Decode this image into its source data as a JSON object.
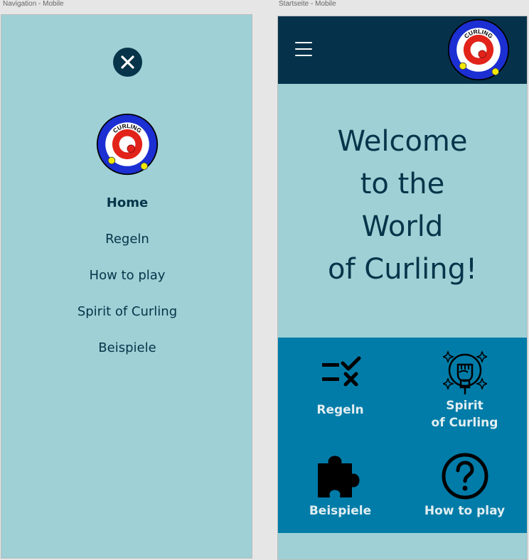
{
  "canvas": {
    "nav_artboard_title": "Navigation - Mobile",
    "home_artboard_title": "Startseite - Mobile"
  },
  "logo": {
    "text": "CURLING",
    "icon": "curling-target-logo"
  },
  "navigation": {
    "close_icon": "close-icon",
    "items": [
      {
        "label": "Home",
        "active": true
      },
      {
        "label": "Regeln",
        "active": false
      },
      {
        "label": "How to play",
        "active": false
      },
      {
        "label": "Spirit of Curling",
        "active": false
      },
      {
        "label": "Beispiele",
        "active": false
      }
    ]
  },
  "home": {
    "menu_icon": "hamburger-menu-icon",
    "welcome_lines": [
      "Welcome",
      "to the",
      "World",
      "of Curling!"
    ],
    "tiles": [
      {
        "label": "Regeln",
        "icon": "checklist-icon"
      },
      {
        "label": "Spirit\nof Curling",
        "icon": "raised-fist-badge-icon"
      },
      {
        "label": "Beispiele",
        "icon": "puzzle-piece-icon"
      },
      {
        "label": "How to play",
        "icon": "question-circle-icon"
      }
    ]
  },
  "colors": {
    "panel_background": "#9ed0d5",
    "dark_navy": "#05324a",
    "tile_blue": "#017ca8",
    "tile_text": "#e2eef1",
    "logo_blue": "#1b2fd3",
    "logo_red": "#e2231a",
    "stone_yellow": "#f3ea00"
  }
}
